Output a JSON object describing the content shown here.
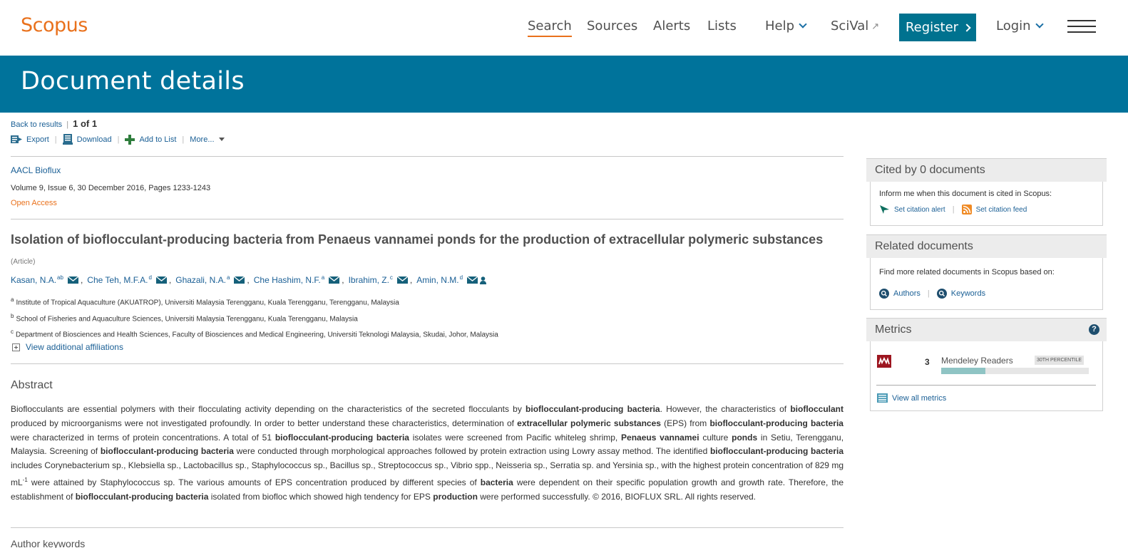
{
  "nav": {
    "logo": "Scopus",
    "search": "Search",
    "sources": "Sources",
    "alerts": "Alerts",
    "lists": "Lists",
    "help": "Help",
    "scival": "SciVal",
    "register": "Register",
    "login": "Login"
  },
  "banner": {
    "title": "Document details"
  },
  "toolbar": {
    "back": "Back to results",
    "separator": "|",
    "count": "1 of 1",
    "export": "Export",
    "download": "Download",
    "add_to_list": "Add to List",
    "more": "More..."
  },
  "source": {
    "journal": "AACL Bioflux",
    "volume": "Volume 9, Issue 6, 30 December 2016, Pages 1233-1243",
    "access": "Open Access"
  },
  "document": {
    "title": "Isolation of bioflocculant-producing bacteria from Penaeus vannamei ponds for the production of extracellular polymeric substances",
    "type": "(Article)"
  },
  "authors": [
    {
      "name": "Kasan, N.A.",
      "sup": "ab"
    },
    {
      "name": "Che Teh, M.F.A.",
      "sup": "d"
    },
    {
      "name": "Ghazali, N.A.",
      "sup": "a"
    },
    {
      "name": "Che Hashim, N.F.",
      "sup": "a"
    },
    {
      "name": "Ibrahim, Z.",
      "sup": "c"
    },
    {
      "name": "Amin, N.M.",
      "sup": "d"
    }
  ],
  "affiliations": [
    {
      "sup": "a",
      "text": "Institute of Tropical Aquaculture (AKUATROP), Universiti Malaysia Terengganu, Kuala Terengganu, Terengganu, Malaysia"
    },
    {
      "sup": "b",
      "text": "School of Fisheries and Aquaculture Sciences, Universiti Malaysia Terengganu, Kuala Terengganu, Malaysia"
    },
    {
      "sup": "c",
      "text": "Department of Biosciences and Health Sciences, Faculty of Biosciences and Medical Engineering, Universiti Teknologi Malaysia, Skudai, Johor, Malaysia"
    }
  ],
  "view_affiliations": "View additional affiliations",
  "abstract": {
    "heading": "Abstract",
    "p1": "Bioflocculants are essential polymers with their flocculating activity depending on the characteristics of the secreted flocculants by ",
    "b1": "bioflocculant-producing bacteria",
    "p2": ". However, the characteristics of ",
    "b2": "bioflocculant",
    "p3": " produced by microorganisms were not investigated profoundly. In order to better understand these characteristics, determination of ",
    "b3": "extracellular polymeric substances",
    "p4": " (EPS) from ",
    "b4": "bioflocculant-producing bacteria",
    "p5": " were characterized in terms of protein concentrations. A total of 51 ",
    "b5": "bioflocculant-producing bacteria",
    "p6": " isolates were screened from Pacific whiteleg shrimp, ",
    "b6": "Penaeus vannamei",
    "p7": " culture ",
    "b7": "ponds",
    "p8": " in Setiu, Terengganu, Malaysia. Screening of ",
    "b8": "bioflocculant-producing bacteria",
    "p9": " were conducted through morphological approaches followed by protein extraction using Lowry assay method. The identified ",
    "b9": "bioflocculant-producing bacteria",
    "p10": " includes Corynebacterium sp., Klebsiella sp., Lactobacillus sp., Staphylococcus sp., Bacillus sp., Streptococcus sp., Vibrio spp., Neisseria sp., Serratia sp. and Yersinia sp., with the highest protein concentration of 829 mg mL",
    "sup": "-1",
    "p11": " were attained by Staphylococcus sp. The various amounts of EPS concentration produced by different species of ",
    "b10": "bacteria",
    "p12": " were dependent on their specific population growth and growth rate. Therefore, the establishment of ",
    "b11": "bioflocculant-producing bacteria",
    "p13": " isolated from biofloc which showed high tendency for EPS ",
    "b12": "production",
    "p14": " were performed successfully. © 2016, BIOFLUX SRL. All rights reserved."
  },
  "keywords_heading": "Author keywords",
  "sidebar": {
    "cited": {
      "title": "Cited by 0 documents",
      "text": "Inform me when this document is cited in Scopus:",
      "alert": "Set citation alert",
      "feed": "Set citation feed"
    },
    "related": {
      "title": "Related documents",
      "text": "Find more related documents in Scopus based on:",
      "authors": "Authors",
      "keywords": "Keywords"
    },
    "metrics": {
      "title": "Metrics",
      "help": "?",
      "count": "3",
      "label": "Mendeley Readers",
      "percentile": "30TH PERCENTILE",
      "percentile_value": 30,
      "view_all": "View all metrics"
    }
  },
  "colors": {
    "brand_orange": "#e9711c",
    "banner": "#00739b",
    "link": "#1a5f95",
    "register": "#00728f"
  }
}
